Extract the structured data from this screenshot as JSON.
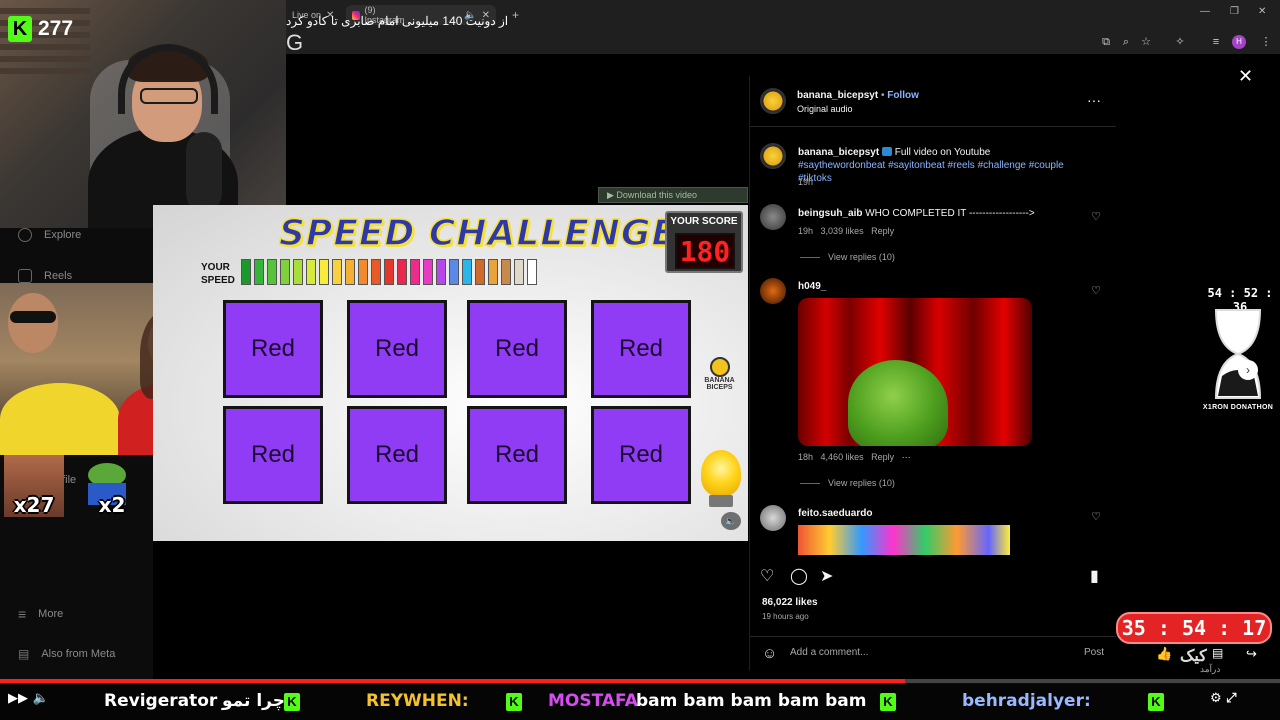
{
  "stream": {
    "kick_viewers": "277",
    "donathon_timer": "54 : 52 : 36",
    "donathon_label": "X1RON DONATHON",
    "countdown": "35 : 54 : 17",
    "multipliers": [
      "x27",
      "x2",
      "x2"
    ],
    "top_banner": "از دونیت 140 میلیونی امام صابری تا کادو کرد"
  },
  "browser": {
    "tabs": [
      {
        "label": "Live on",
        "active": false
      },
      {
        "label": "(9) Instagram",
        "active": true
      }
    ],
    "address_letter": "G"
  },
  "left_nav": {
    "items": [
      {
        "label": "Explore",
        "icon": "compass-icon"
      },
      {
        "label": "Reels",
        "icon": "reels-icon"
      },
      {
        "label": "ofile",
        "icon": "profile-icon"
      },
      {
        "label": "More",
        "icon": "menu-icon"
      },
      {
        "label": "Also from Meta",
        "icon": "meta-icon"
      }
    ]
  },
  "video": {
    "title": "SPEED CHALLENGE",
    "your_score_label": "YOUR SCORE",
    "score": "180",
    "speed_label_1": "YOUR",
    "speed_label_2": "SPEED",
    "tile_word": "Red",
    "tiles": [
      "Red",
      "Red",
      "Red",
      "Red",
      "Red",
      "Red",
      "Red",
      "Red"
    ],
    "brand": "BANANA BICEPS",
    "download_text": "Download this video",
    "speed_colors": [
      "#1a9a2c",
      "#34b43a",
      "#55c43a",
      "#7ed13a",
      "#a9de3a",
      "#d7ea3c",
      "#f7ec3c",
      "#f7d23c",
      "#f5b034",
      "#f08a2c",
      "#ea5a28",
      "#e4362a",
      "#e82850",
      "#ee2a8a",
      "#e63cc4",
      "#b448e8",
      "#5a8ae8",
      "#2ab6e8",
      "#d06a28",
      "#e8a43c",
      "#c88a4a",
      "#e0d8c8",
      "#ffffff"
    ]
  },
  "post": {
    "author": "banana_bicepsyt",
    "follow_label": "Follow",
    "audio": "Original audio",
    "caption_user": "banana_bicepsyt",
    "caption_text": "Full video on Youtube",
    "caption_tags": "#saythewordonbeat #sayitonbeat #reels #challenge #couple #tiktoks",
    "caption_time": "19h",
    "likes": "86,022 likes",
    "ago": "19 hours ago",
    "comment_placeholder": "Add a comment...",
    "post_label": "Post"
  },
  "comments": [
    {
      "user": "beingsuh_aib",
      "text": "WHO COMPLETED IT ------------------>",
      "time": "19h",
      "likes": "3,039 likes",
      "reply": "Reply",
      "replies": "View replies (10)"
    },
    {
      "user": "h049_",
      "text": "",
      "time": "18h",
      "likes": "4,460 likes",
      "reply": "Reply",
      "replies": "View replies (10)"
    },
    {
      "user": "feito.saeduardo",
      "text": "",
      "time": "",
      "likes": "",
      "reply": "",
      "replies": ""
    }
  ],
  "ticker": {
    "items": [
      {
        "text": "Revigerator",
        "color": "#ffffff"
      },
      {
        "text": "چرا تمو",
        "color": "#ffffff"
      },
      {
        "text": "REYWHEN:",
        "color": "#f5c22a"
      },
      {
        "text": "MOSTAFA",
        "color": "#d74cf0"
      },
      {
        "text": "bam bam bam bam bam",
        "color": "#ffffff"
      },
      {
        "text": "behradjalyer:",
        "color": "#9ab8ff"
      }
    ]
  },
  "overlay_right": {
    "kick_label": "کیک",
    "kick_sub": "درآمد"
  }
}
